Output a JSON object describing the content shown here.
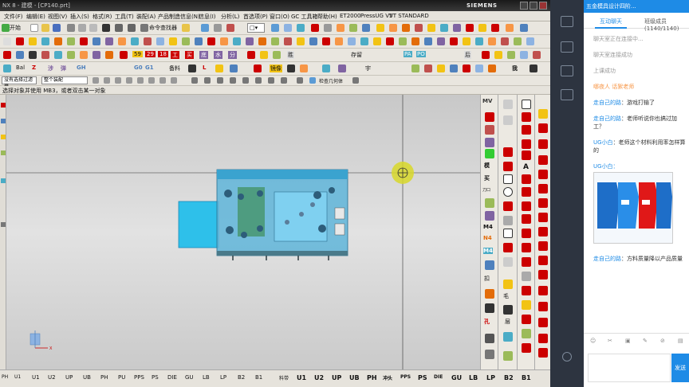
{
  "titlebar": {
    "title": "NX 8 - 建模 - [CP140.prt]",
    "brand": "SIEMENS"
  },
  "menu": [
    "文件(F)",
    "编辑(E)",
    "视图(V)",
    "插入(S)",
    "格式(R)",
    "工具(T)",
    "装配(A)",
    "产品制造信息(N)",
    "信息(I)",
    "分析(L)",
    "首选项(P)",
    "窗口(O)",
    "GC 工具箱",
    "帮助(H)",
    "ET2000",
    "PressUG V5",
    "VT STANDARD"
  ],
  "toolbar1": {
    "start_label": "开始",
    "cmd_finder": "命令查找器"
  },
  "toolbar3": {
    "labels": [
      "59",
      "29",
      "18",
      "工",
      "买",
      "底",
      "水",
      "分",
      "胜",
      "存留",
      "PA",
      "PO",
      "后"
    ]
  },
  "toolbar4": {
    "labels": [
      "Bal",
      "Z",
      "涉",
      "弹",
      "GH",
      "G0",
      "G1",
      "备料",
      "L",
      "镜像",
      "宇",
      "我"
    ]
  },
  "toolbar5": {
    "filter_label": "没有选择过滤器",
    "assembly_label": "整个装配",
    "check_label": "检查几何体"
  },
  "hint": {
    "text": "选择对象并使用 MB3，或者双击某一对象"
  },
  "bottom_tabs_left": [
    "PH",
    "U1",
    "U2",
    "UP",
    "UB",
    "PH",
    "PU",
    "PPS",
    "PS",
    "DIE",
    "GU",
    "LB",
    "LP",
    "B2",
    "B1"
  ],
  "bottom_tabs_right": [
    "料带",
    "U1",
    "U2",
    "UP",
    "UB",
    "PH",
    "冲头",
    "PPS",
    "PS",
    "DIE",
    "GU",
    "LB",
    "LP",
    "B2",
    "B1"
  ],
  "right_palette": [
    "MV",
    "模",
    "买",
    "刀口",
    "M4",
    "N4",
    "M4",
    "扣",
    "孔"
  ],
  "triad": {
    "x_label": "X",
    "y_label": "Y",
    "z_label": "Z"
  },
  "chat": {
    "header_title": "五金模具设计四阶...",
    "tabs": [
      "互动聊天",
      "班级成员(1140/1140)"
    ],
    "messages": [
      {
        "type": "system",
        "text": "聊天室正在连接中..."
      },
      {
        "type": "system",
        "text": "聊天室连接成功"
      },
      {
        "type": "system",
        "text": "上课成功"
      },
      {
        "type": "teacher",
        "name": "哪夜人 话絮老师",
        "text": ""
      },
      {
        "type": "user",
        "name": "走自己的路",
        "text": "：游戏打输了"
      },
      {
        "type": "user",
        "name": "走自己的路",
        "text": "：老师听说你也搞过加工？"
      },
      {
        "type": "user",
        "name": "UG小白",
        "text": "：老师这个材料利用率怎样算的"
      },
      {
        "type": "image",
        "name": "UG小白：",
        "text": ""
      },
      {
        "type": "user",
        "name": "走自己的路",
        "text": "：方料质量降以产品质量"
      }
    ],
    "send_label": "发送"
  },
  "colors": {
    "accent": "#1e8be6",
    "part": "#2ec0ea",
    "viewport_top": "#c8c8c8"
  }
}
